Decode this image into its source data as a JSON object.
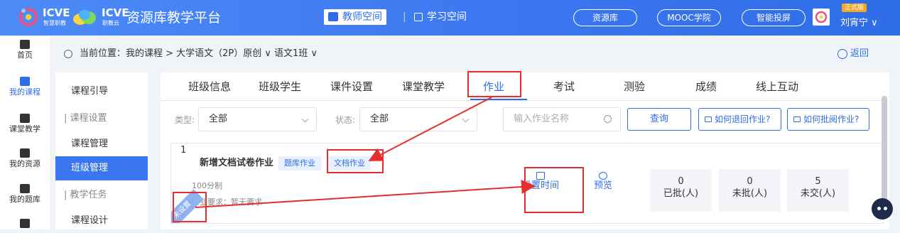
{
  "header": {
    "logo1_text": "ICVE",
    "logo1_sub": "智慧职教",
    "logo2_text": "ICVE",
    "logo2_sub": "职教云",
    "platform_title": "资源库教学平台",
    "teacher_tab": "教师空间",
    "separator": "|",
    "study_tab": "学习空间",
    "pills": [
      "资源库",
      "MOOC学院",
      "智能投屏"
    ],
    "badge": "正式版",
    "username": "刘宵宁 ∨",
    "colors": {
      "bar": "#3a76ef",
      "accent": "#2f6de8",
      "highlight": "#e62e2e"
    }
  },
  "left_nav": [
    {
      "label": "首页",
      "icon": "home-icon"
    },
    {
      "label": "我的课程",
      "icon": "course-icon",
      "active": true
    },
    {
      "label": "课堂教学",
      "icon": "classroom-icon"
    },
    {
      "label": "我的资源",
      "icon": "resource-icon"
    },
    {
      "label": "我的题库",
      "icon": "question-bank-icon"
    },
    {
      "label": "",
      "icon": "more-icon"
    }
  ],
  "breadcrumb": {
    "text": "当前位置：我的课程 > 大学语文（2P）原创 ∨ 语文1班 ∨",
    "back": "返回"
  },
  "side_menu": [
    {
      "label": "课程引导",
      "type": "item"
    },
    {
      "label": "| 课程设置",
      "type": "section"
    },
    {
      "label": "课程管理",
      "type": "item"
    },
    {
      "label": "班级管理",
      "type": "item",
      "active": true
    },
    {
      "label": "| 教学任务",
      "type": "section"
    },
    {
      "label": "课程设计",
      "type": "item"
    }
  ],
  "tabs": [
    {
      "label": "班级信息"
    },
    {
      "label": "班级学生"
    },
    {
      "label": "课件设置"
    },
    {
      "label": "课堂教学"
    },
    {
      "label": "作业",
      "active": true
    },
    {
      "label": "考试"
    },
    {
      "label": "测验"
    },
    {
      "label": "成绩"
    },
    {
      "label": "线上互动"
    }
  ],
  "filters": {
    "type_label": "类型:",
    "type_value": "全部",
    "status_label": "状态:",
    "status_value": "全部",
    "search_placeholder": "输入作业名称",
    "query_button": "查询",
    "help1": "如何退回作业?",
    "help2": "如何批阅作业?"
  },
  "homework": {
    "index": "1",
    "title": "新增文档试卷作业",
    "tag_bank": "题库作业",
    "tag_doc": "文档作业",
    "score": "100分制",
    "requirement": "作业要求：暂无要求",
    "ribbon": "未设置",
    "action_time": "设置时间",
    "action_preview": "预览",
    "stats": [
      {
        "value": "0",
        "label": "已批(人)"
      },
      {
        "value": "0",
        "label": "未批(人)"
      },
      {
        "value": "5",
        "label": "未交(人)"
      }
    ]
  }
}
